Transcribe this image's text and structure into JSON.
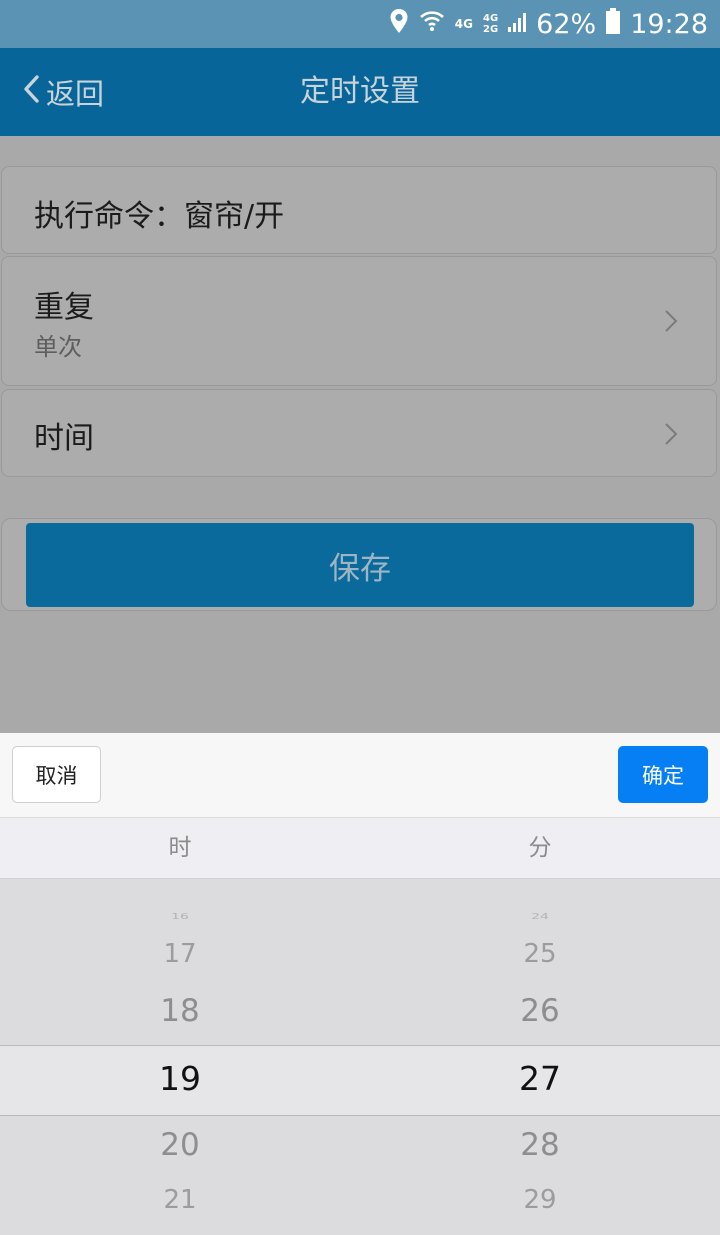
{
  "status_bar": {
    "net1": "4G",
    "net2_top": "4G",
    "net2_bottom": "2G",
    "battery": "62%",
    "time": "19:28",
    "icons": [
      "location-icon",
      "wifi-icon",
      "signal-icon",
      "battery-icon"
    ]
  },
  "nav": {
    "back_label": "返回",
    "title": "定时设置"
  },
  "form": {
    "command_label": "执行命令：窗帘/开",
    "repeat_label": "重复",
    "repeat_value": "单次",
    "time_label": "时间",
    "save_label": "保存"
  },
  "picker": {
    "cancel_label": "取消",
    "confirm_label": "确定",
    "hour_header": "时",
    "minute_header": "分",
    "hours": [
      "16",
      "17",
      "18",
      "19",
      "20",
      "21"
    ],
    "minutes": [
      "24",
      "25",
      "26",
      "27",
      "28",
      "29"
    ],
    "selected_hour": "19",
    "selected_minute": "27"
  },
  "colors": {
    "nav_bar": "#07659a",
    "status_bar": "#5a93b4",
    "save_button": "#0a6a9b",
    "confirm_button": "#067ff5"
  }
}
